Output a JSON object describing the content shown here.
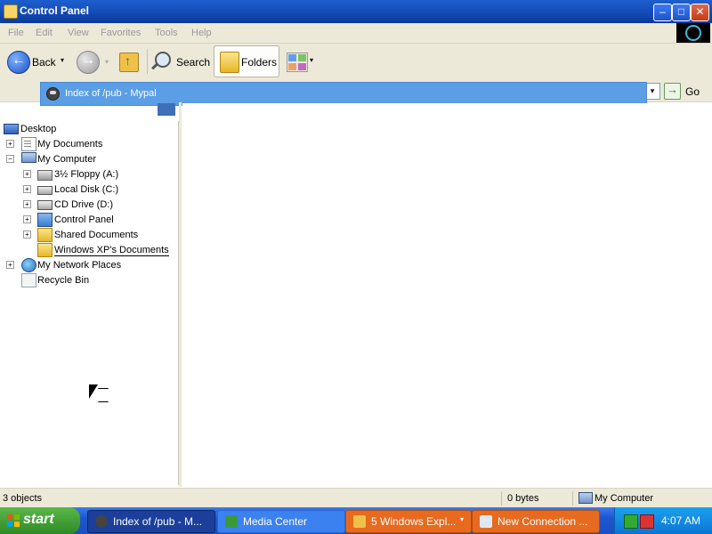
{
  "window": {
    "title": "Control Panel"
  },
  "window_controls": {
    "minimize": "–",
    "maximize": "□",
    "close": "✕"
  },
  "menu": [
    "File",
    "Edit",
    "View",
    "Favorites",
    "Tools",
    "Help"
  ],
  "toolbar": {
    "back_label": "Back",
    "search_label": "Search",
    "folders_label": "Folders",
    "caret": "▾"
  },
  "address": {
    "go_label": "Go",
    "dropdown_item": "Index of /pub - Mypal"
  },
  "tree": [
    {
      "label": "Desktop",
      "icon": "desktop-icon",
      "expander": ""
    },
    {
      "label": "My Documents",
      "icon": "my-documents-icon",
      "expander": "+"
    },
    {
      "label": "My Computer",
      "icon": "my-computer-icon",
      "expander": "−"
    },
    {
      "label": "3½ Floppy (A:)",
      "icon": "floppy-drive-icon",
      "expander": "+"
    },
    {
      "label": "Local Disk (C:)",
      "icon": "local-disk-icon",
      "expander": "+"
    },
    {
      "label": "CD Drive (D:)",
      "icon": "cd-drive-icon",
      "expander": "+"
    },
    {
      "label": "Control Panel",
      "icon": "control-panel-icon",
      "expander": "+"
    },
    {
      "label": "Shared Documents",
      "icon": "folder-icon",
      "expander": "+"
    },
    {
      "label": "Windows XP's Documents",
      "icon": "folder-icon",
      "expander": ""
    },
    {
      "label": "My Network Places",
      "icon": "network-places-icon",
      "expander": "+"
    },
    {
      "label": "Recycle Bin",
      "icon": "recycle-bin-icon",
      "expander": ""
    }
  ],
  "status": {
    "objects": "3 objects",
    "size": "0 bytes",
    "location": "My Computer"
  },
  "taskbar": {
    "start_label": "start",
    "tasks": [
      {
        "label": "Index of /pub - M..."
      },
      {
        "label": "Media Center"
      },
      {
        "label": "5 Windows Expl..."
      },
      {
        "label": "New Connection ..."
      }
    ],
    "clock": "4:07 AM"
  }
}
